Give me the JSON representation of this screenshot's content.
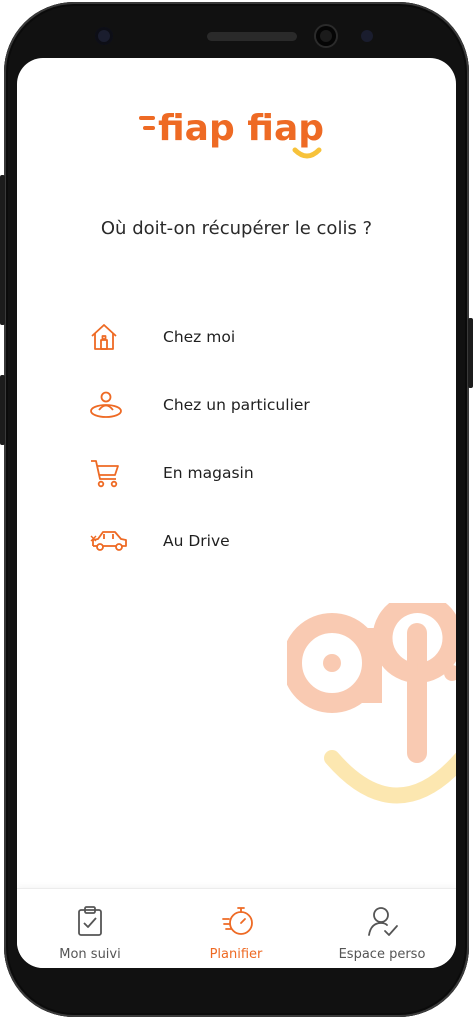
{
  "app": {
    "logo_text": "fiap fiap",
    "brand_color": "#ee6a24",
    "smile_color": "#f7c23a"
  },
  "question": "Où doit-on récupérer le colis ?",
  "options": [
    {
      "label": "Chez moi",
      "icon": "home-icon"
    },
    {
      "label": "Chez un particulier",
      "icon": "person-location-icon"
    },
    {
      "label": "En magasin",
      "icon": "shopping-cart-icon"
    },
    {
      "label": "Au Drive",
      "icon": "car-icon"
    }
  ],
  "bottom_nav": {
    "items": [
      {
        "label": "Mon suivi",
        "icon": "clipboard-check-icon",
        "active": false
      },
      {
        "label": "Planifier",
        "icon": "stopwatch-icon",
        "active": true
      },
      {
        "label": "Espace perso",
        "icon": "user-check-icon",
        "active": false
      }
    ]
  }
}
